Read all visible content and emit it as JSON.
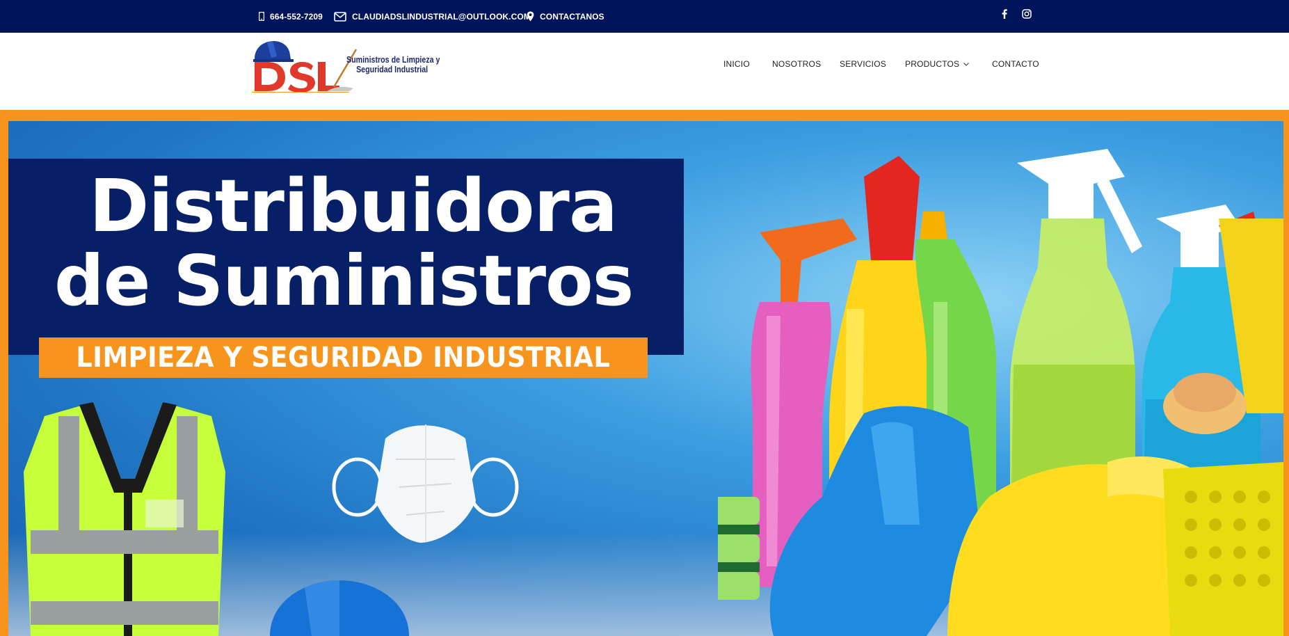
{
  "topbar": {
    "phone": "664-552-7209",
    "email": "CLAUDIADSLINDUSTRIAL@OUTLOOK.COM",
    "location": "CONTACTANOS",
    "icons": [
      "mobile-phone-icon",
      "envelope-icon",
      "map-pin-icon",
      "facebook-icon",
      "instagram-icon"
    ]
  },
  "logo": {
    "letters": "DSL",
    "tagline_line1": "Suministros de Limpieza y",
    "tagline_line2": "Seguridad Industrial"
  },
  "nav": {
    "items": [
      {
        "label": "INICIO"
      },
      {
        "label": "NOSOTROS"
      },
      {
        "label": "SERVICIOS"
      },
      {
        "label": "PRODUCTOS",
        "has_dropdown": true
      },
      {
        "label": "CONTACTO"
      }
    ]
  },
  "hero": {
    "title_line1": "Distribuidora",
    "title_line2": "de Suministros",
    "subtitle": "LIMPIEZA Y SEGURIDAD INDUSTRIAL",
    "images": [
      "safety-vest",
      "face-mask",
      "hard-hat",
      "cleaning-spray-bottles",
      "sponges",
      "rubber-gloves",
      "trash-bags",
      "cleaning-basket"
    ]
  },
  "colors": {
    "topbar_bg": "#001559",
    "accent_orange": "#f7941d",
    "title_box_bg": "#061f66",
    "logo_blue": "#1c2a6b",
    "logo_red": "#e0392b"
  }
}
